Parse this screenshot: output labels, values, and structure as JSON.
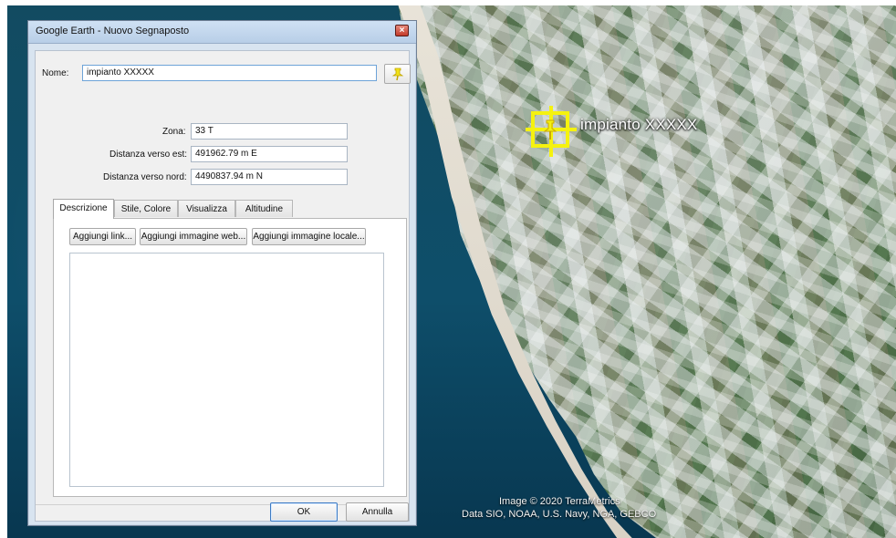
{
  "dialog": {
    "title": "Google Earth - Nuovo Segnaposto",
    "name_label": "Nome:",
    "name_value": "impianto XXXXX",
    "fields": {
      "zone_label": "Zona:",
      "zone_value": "33 T",
      "east_label": "Distanza verso est:",
      "east_value": "491962.79 m E",
      "north_label": "Distanza verso nord:",
      "north_value": "4490837.94 m N"
    },
    "tabs": [
      {
        "label": "Descrizione",
        "active": true
      },
      {
        "label": "Stile, Colore",
        "active": false
      },
      {
        "label": "Visualizza",
        "active": false
      },
      {
        "label": "Altitudine",
        "active": false
      }
    ],
    "description_buttons": {
      "link": "Aggiungi link...",
      "web_image": "Aggiungi immagine web...",
      "local_image": "Aggiungi immagine locale..."
    },
    "footer": {
      "ok": "OK",
      "cancel": "Annulla"
    },
    "icons": {
      "close": "close-icon",
      "pushpin": "pushpin-icon"
    }
  },
  "map": {
    "placemark_label": "impianto XXXXX",
    "credits": {
      "image": "Image © 2020 TerraMetrics",
      "data": "Data SIO, NOAA, U.S. Navy, NGA, GEBCO"
    },
    "marker_color": "#f5f20f"
  }
}
